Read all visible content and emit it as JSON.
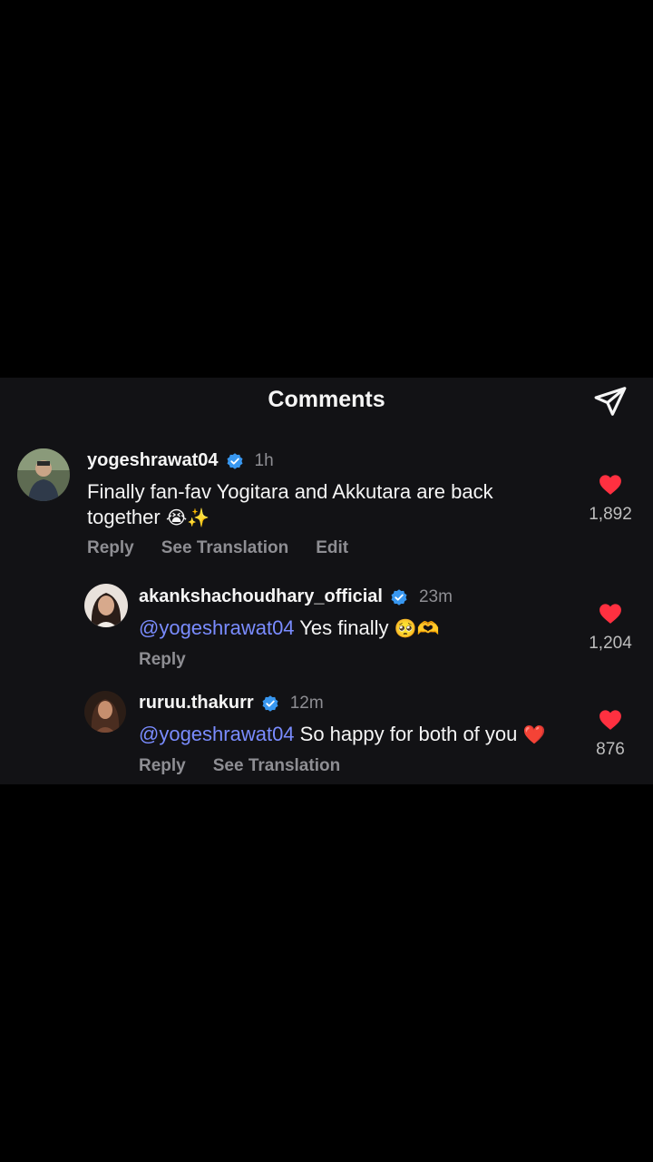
{
  "header": {
    "title": "Comments"
  },
  "comments": [
    {
      "username": "yogeshrawat04",
      "time": "1h",
      "text": "Finally fan-fav Yogitara and Akkutara are back together",
      "emoji": "😭✨",
      "actions": [
        "Reply",
        "See Translation",
        "Edit"
      ],
      "likes": "1,892"
    },
    {
      "username": "akankshachoudhary_official",
      "time": "23m",
      "mention": "@yogeshrawat04",
      "text": " Yes finally ",
      "emoji": "🥺🫶",
      "actions": [
        "Reply"
      ],
      "likes": "1,204"
    },
    {
      "username": "ruruu.thakurr",
      "time": "12m",
      "mention": "@yogeshrawat04",
      "text": " So happy for both of you ",
      "emoji": "❤️",
      "actions": [
        "Reply",
        "See Translation"
      ],
      "likes": "876"
    }
  ],
  "icons": {
    "send": "send-icon",
    "verified": "verified-badge-icon",
    "heart": "heart-icon"
  },
  "colors": {
    "background": "#000000",
    "panel": "#121215",
    "mention": "#7a8cff",
    "verified": "#3897f0",
    "heart": "#ff3040",
    "muted": "#8e8e93"
  }
}
